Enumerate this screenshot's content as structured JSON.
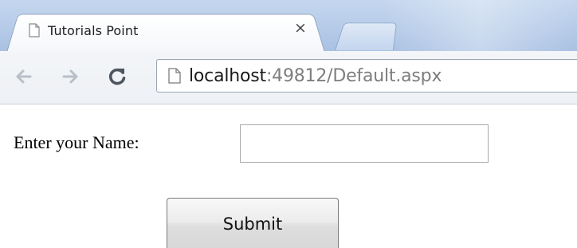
{
  "browser": {
    "tabs": [
      {
        "title": "Tutorials Point",
        "active": true,
        "icon": "page-icon"
      }
    ],
    "tab_close_glyph": "×",
    "toolbar": {
      "back_icon": "back-arrow-icon",
      "forward_icon": "forward-arrow-icon",
      "reload_icon": "reload-icon"
    },
    "address_bar": {
      "host": "localhost",
      "rest": ":49812/Default.aspx",
      "icon": "page-icon"
    }
  },
  "form": {
    "name_label": "Enter your Name:",
    "name_value": "",
    "submit_label": "Submit"
  },
  "colors": {
    "tabstrip": "#b6cbe8",
    "url_host": "#1a1a1a",
    "url_rest": "#7e7e7e"
  }
}
